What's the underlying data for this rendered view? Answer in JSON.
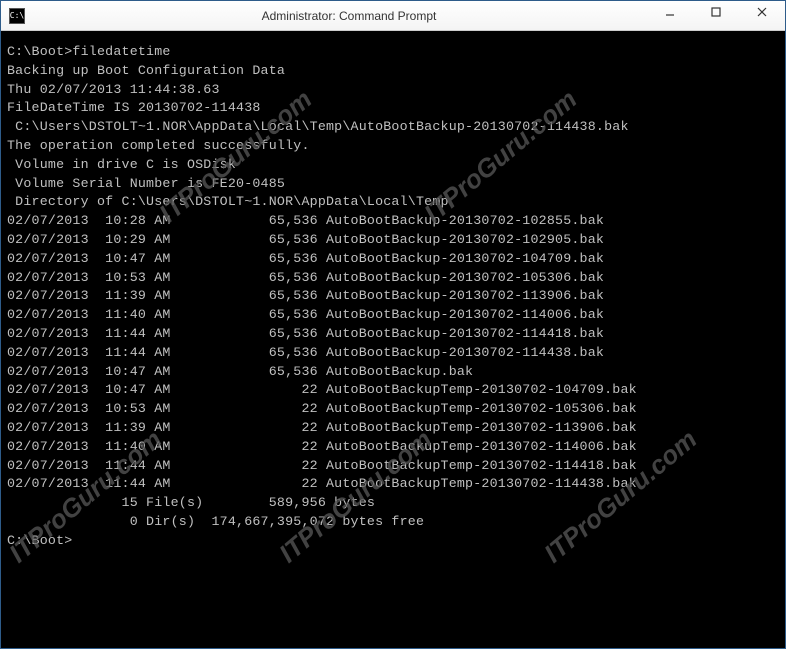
{
  "window": {
    "title": "Administrator: Command Prompt",
    "icon_glyph": "C:\\"
  },
  "prompt1": "C:\\Boot>filedatetime",
  "lines_header": [
    "Backing up Boot Configuration Data",
    "Thu 02/07/2013 11:44:38.63",
    "FileDateTime IS 20130702-114438",
    " C:\\Users\\DSTOLT~1.NOR\\AppData\\Local\\Temp\\AutoBootBackup-20130702-114438.bak",
    "The operation completed successfully.",
    " Volume in drive C is OSDisk",
    " Volume Serial Number is FE20-0485",
    "",
    " Directory of C:\\Users\\DSTOLT~1.NOR\\AppData\\Local\\Temp",
    ""
  ],
  "files": [
    {
      "date": "02/07/2013",
      "time": "10:28 AM",
      "size": "65,536",
      "name": "AutoBootBackup-20130702-102855.bak"
    },
    {
      "date": "02/07/2013",
      "time": "10:29 AM",
      "size": "65,536",
      "name": "AutoBootBackup-20130702-102905.bak"
    },
    {
      "date": "02/07/2013",
      "time": "10:47 AM",
      "size": "65,536",
      "name": "AutoBootBackup-20130702-104709.bak"
    },
    {
      "date": "02/07/2013",
      "time": "10:53 AM",
      "size": "65,536",
      "name": "AutoBootBackup-20130702-105306.bak"
    },
    {
      "date": "02/07/2013",
      "time": "11:39 AM",
      "size": "65,536",
      "name": "AutoBootBackup-20130702-113906.bak"
    },
    {
      "date": "02/07/2013",
      "time": "11:40 AM",
      "size": "65,536",
      "name": "AutoBootBackup-20130702-114006.bak"
    },
    {
      "date": "02/07/2013",
      "time": "11:44 AM",
      "size": "65,536",
      "name": "AutoBootBackup-20130702-114418.bak"
    },
    {
      "date": "02/07/2013",
      "time": "11:44 AM",
      "size": "65,536",
      "name": "AutoBootBackup-20130702-114438.bak"
    },
    {
      "date": "02/07/2013",
      "time": "10:47 AM",
      "size": "65,536",
      "name": "AutoBootBackup.bak"
    },
    {
      "date": "02/07/2013",
      "time": "10:47 AM",
      "size": "22",
      "name": "AutoBootBackupTemp-20130702-104709.bak"
    },
    {
      "date": "02/07/2013",
      "time": "10:53 AM",
      "size": "22",
      "name": "AutoBootBackupTemp-20130702-105306.bak"
    },
    {
      "date": "02/07/2013",
      "time": "11:39 AM",
      "size": "22",
      "name": "AutoBootBackupTemp-20130702-113906.bak"
    },
    {
      "date": "02/07/2013",
      "time": "11:40 AM",
      "size": "22",
      "name": "AutoBootBackupTemp-20130702-114006.bak"
    },
    {
      "date": "02/07/2013",
      "time": "11:44 AM",
      "size": "22",
      "name": "AutoBootBackupTemp-20130702-114418.bak"
    },
    {
      "date": "02/07/2013",
      "time": "11:44 AM",
      "size": "22",
      "name": "AutoBootBackupTemp-20130702-114438.bak"
    }
  ],
  "summary": {
    "files_line": "              15 File(s)        589,956 bytes",
    "dirs_line": "               0 Dir(s)  174,667,395,072 bytes free"
  },
  "prompt2": "C:\\Boot>",
  "watermark_text": "ITProGuru.com"
}
